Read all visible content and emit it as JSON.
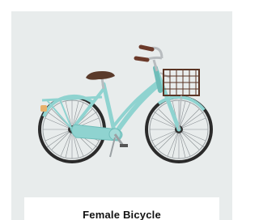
{
  "caption": {
    "text": "Female Bicycle"
  },
  "colors": {
    "background": "#e8ecec",
    "frame": "#8fd3d0",
    "frame_dark": "#6fbdb9",
    "tire": "#2b2b2b",
    "saddle": "#5a3b2b",
    "basket": "#5a3424",
    "grips": "#6b3a2a",
    "chrome": "#b8bcbf"
  },
  "icons": [
    "bicycle-illustration",
    "basket-icon",
    "saddle-icon"
  ]
}
